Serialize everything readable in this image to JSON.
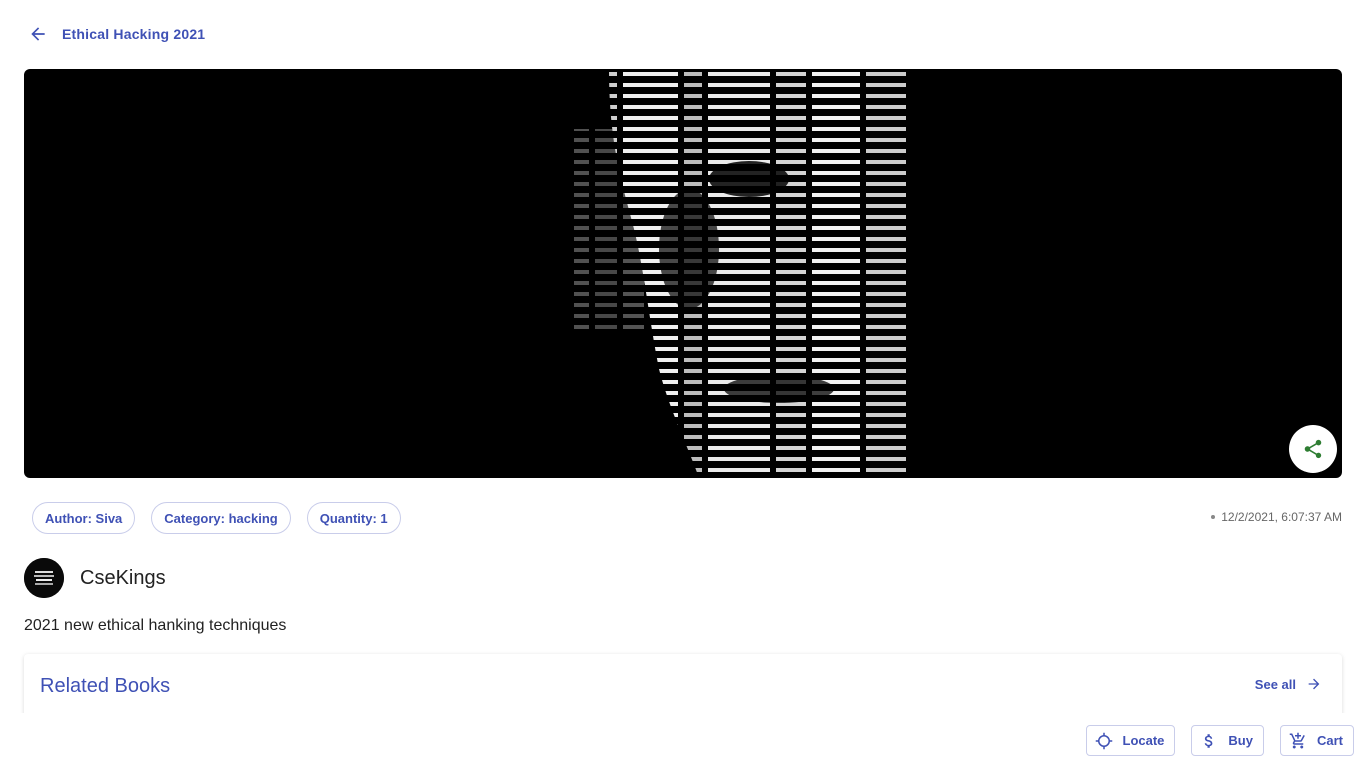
{
  "header": {
    "back_icon": "arrow-left-icon",
    "title": "Ethical Hacking 2021"
  },
  "hero": {
    "share_icon": "share-icon"
  },
  "chips": [
    {
      "label": "Author: Siva"
    },
    {
      "label": "Category: hacking"
    },
    {
      "label": "Quantity: 1"
    }
  ],
  "timestamp": "12/2/2021, 6:07:37 AM",
  "owner": {
    "name": "CseKings"
  },
  "description": "2021 new ethical hanking techniques",
  "related": {
    "title": "Related Books",
    "see_all": "See all",
    "see_all_icon": "arrow-right-icon"
  },
  "actions": [
    {
      "label": "Locate",
      "icon": "locate-icon"
    },
    {
      "label": "Buy",
      "icon": "dollar-icon"
    },
    {
      "label": "Cart",
      "icon": "cart-icon"
    }
  ],
  "colors": {
    "accent": "#3f51b5",
    "hero_bg": "#000000",
    "share_icon": "#2e7d32"
  }
}
